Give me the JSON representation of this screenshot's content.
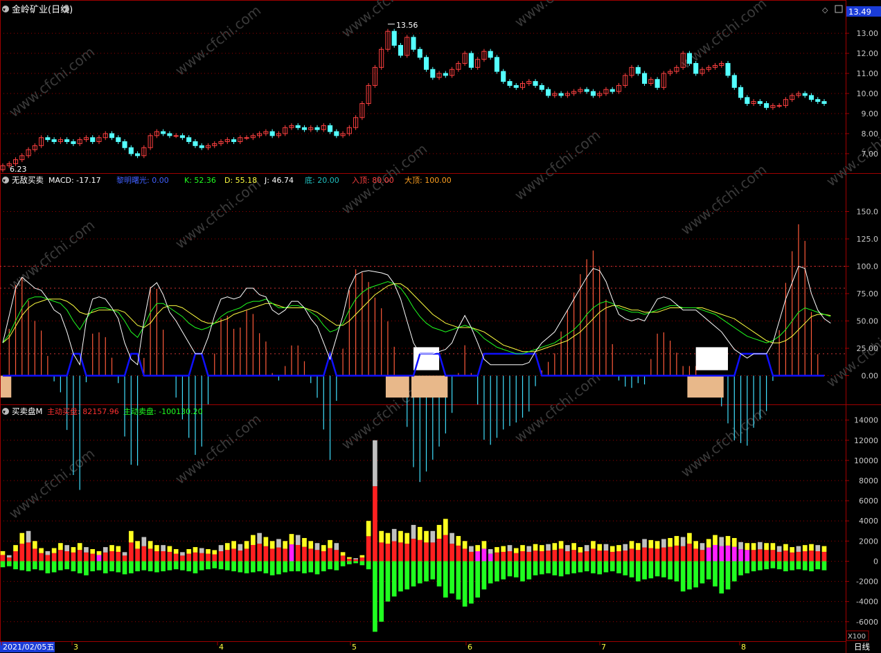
{
  "colors": {
    "up": "#ff4040",
    "down": "#54ffff",
    "frame": "#a00000",
    "grid": "#a00000",
    "axis_text": "#c8c8c8",
    "k_line": "#ffffff",
    "d_line": "#ffff40",
    "j_line": "#20ff20",
    "bottom_line": "#1010ff",
    "zone_fill": "#e8b88a",
    "buy_red": "#ff2020",
    "buy_yellow": "#ffff20",
    "buy_gray": "#c0c0c0",
    "buy_magenta": "#ff20ff",
    "sell_green": "#20ff20",
    "macd_pos": "#ff5a3a",
    "macd_neg": "#40e0ff"
  },
  "price_panel": {
    "title": "金岭矿业(日线)",
    "current_price": "13.49",
    "high_label": "13.56",
    "low_label": "6.23",
    "y_ticks": [
      "13.00",
      "12.00",
      "11.00",
      "10.00",
      "9.00",
      "8.00",
      "7.00"
    ]
  },
  "indicator_panel": {
    "title": "无敌买卖",
    "labels": [
      {
        "text": "MACD: -17.17",
        "color": "#ffffff"
      },
      {
        "text": "黎明曙光: 0.00",
        "color": "#4060ff"
      },
      {
        "text": "K: 52.36",
        "color": "#20ff20"
      },
      {
        "text": "D: 55.18",
        "color": "#ffff40"
      },
      {
        "text": "J: 46.74",
        "color": "#ffffff"
      },
      {
        "text": "底: 20.00",
        "color": "#20c0c0"
      },
      {
        "text": "入顶: 80.00",
        "color": "#ff4040"
      },
      {
        "text": "大顶: 100.00",
        "color": "#ffa020"
      }
    ],
    "y_ticks": [
      "150.0",
      "125.0",
      "100.0",
      "75.00",
      "50.00",
      "25.00",
      "0.00"
    ]
  },
  "volume_panel": {
    "title": "买卖盘M",
    "labels": [
      {
        "text": "主动买盘: 82157.96",
        "color": "#ff3030"
      },
      {
        "text": "主动卖盘: -100130.20",
        "color": "#20ff20"
      }
    ],
    "y_ticks": [
      "14000",
      "12000",
      "10000",
      "8000",
      "6000",
      "4000",
      "2000",
      "0",
      "-2000",
      "-4000",
      "-6000"
    ]
  },
  "x_axis": {
    "labels": [
      "2021/02/05五",
      "3",
      "4",
      "5",
      "6",
      "7",
      "8"
    ],
    "period": "日线",
    "zoom": "X100"
  },
  "watermark": "www.cfchi.com",
  "chart_data": [
    {
      "type": "candlestick",
      "title": "金岭矿业(日线)",
      "ylim": [
        6.1,
        13.9
      ],
      "high": 13.56,
      "low": 6.23,
      "close": [
        6.4,
        6.5,
        6.7,
        6.9,
        7.2,
        7.4,
        7.8,
        7.7,
        7.6,
        7.7,
        7.6,
        7.5,
        7.7,
        7.8,
        7.6,
        7.8,
        8.0,
        7.8,
        7.6,
        7.3,
        7.0,
        6.9,
        7.3,
        7.9,
        8.1,
        8.0,
        7.9,
        7.9,
        7.8,
        7.6,
        7.4,
        7.3,
        7.4,
        7.5,
        7.6,
        7.7,
        7.6,
        7.8,
        7.8,
        7.9,
        8.0,
        8.1,
        7.9,
        8.0,
        8.3,
        8.4,
        8.3,
        8.2,
        8.3,
        8.2,
        8.4,
        8.1,
        7.9,
        8.0,
        8.3,
        8.8,
        9.5,
        10.4,
        11.3,
        12.2,
        13.1,
        12.4,
        11.9,
        12.8,
        12.2,
        11.8,
        11.2,
        10.8,
        11.0,
        10.9,
        11.2,
        11.5,
        12.0,
        11.3,
        11.7,
        12.1,
        11.8,
        11.1,
        10.6,
        10.4,
        10.3,
        10.5,
        10.6,
        10.4,
        10.2,
        9.9,
        10.0,
        9.9,
        10.0,
        10.1,
        10.2,
        10.1,
        9.9,
        10.0,
        10.2,
        10.1,
        10.4,
        10.9,
        11.3,
        11.0,
        10.5,
        10.7,
        10.3,
        11.0,
        11.1,
        11.3,
        12.0,
        11.5,
        11.0,
        11.2,
        11.3,
        11.4,
        11.5,
        10.9,
        10.3,
        9.8,
        9.5,
        9.6,
        9.5,
        9.3,
        9.4,
        9.4,
        9.7,
        9.9,
        10.0,
        9.9,
        9.7,
        9.6,
        9.5
      ]
    },
    {
      "type": "line",
      "title": "无敌买卖",
      "ylim": [
        -25,
        175
      ],
      "series": [
        {
          "name": "K",
          "values": [
            30,
            38,
            50,
            62,
            70,
            72,
            72,
            70,
            68,
            66,
            60,
            50,
            42,
            52,
            60,
            62,
            62,
            60,
            58,
            50,
            40,
            35,
            45,
            58,
            66,
            66,
            62,
            58,
            54,
            48,
            44,
            42,
            44,
            48,
            54,
            58,
            60,
            62,
            66,
            68,
            68,
            70,
            66,
            62,
            62,
            64,
            64,
            62,
            58,
            54,
            46,
            40,
            42,
            48,
            60,
            70,
            76,
            80,
            82,
            84,
            86,
            84,
            80,
            72,
            62,
            54,
            48,
            44,
            42,
            40,
            42,
            44,
            46,
            44,
            40,
            34,
            30,
            26,
            24,
            22,
            20,
            20,
            22,
            24,
            26,
            28,
            30,
            34,
            38,
            42,
            48,
            56,
            62,
            66,
            68,
            66,
            62,
            60,
            58,
            58,
            56,
            58,
            60,
            62,
            64,
            64,
            62,
            62,
            62,
            60,
            58,
            56,
            52,
            48,
            44,
            40,
            36,
            34,
            32,
            30,
            32,
            36,
            42,
            50,
            58,
            62,
            60,
            58,
            56,
            54
          ]
        },
        {
          "name": "D",
          "values": [
            30,
            35,
            45,
            55,
            62,
            66,
            68,
            70,
            70,
            70,
            68,
            64,
            58,
            56,
            58,
            60,
            60,
            60,
            60,
            58,
            52,
            46,
            44,
            48,
            56,
            62,
            64,
            64,
            62,
            58,
            54,
            50,
            48,
            48,
            50,
            52,
            56,
            58,
            60,
            62,
            64,
            66,
            66,
            64,
            62,
            62,
            62,
            62,
            60,
            58,
            54,
            50,
            46,
            46,
            50,
            56,
            62,
            68,
            74,
            78,
            82,
            84,
            84,
            80,
            74,
            68,
            62,
            56,
            52,
            48,
            46,
            44,
            44,
            44,
            42,
            40,
            36,
            32,
            28,
            26,
            24,
            22,
            22,
            22,
            24,
            26,
            28,
            30,
            32,
            36,
            40,
            46,
            52,
            58,
            62,
            64,
            64,
            62,
            60,
            60,
            58,
            58,
            58,
            60,
            62,
            62,
            62,
            62,
            62,
            62,
            60,
            58,
            56,
            54,
            52,
            48,
            44,
            40,
            36,
            32,
            30,
            30,
            32,
            36,
            42,
            48,
            54,
            56,
            56,
            55
          ]
        },
        {
          "name": "J",
          "values": [
            30,
            55,
            80,
            90,
            85,
            80,
            78,
            70,
            60,
            56,
            40,
            20,
            10,
            50,
            70,
            72,
            70,
            62,
            52,
            30,
            15,
            10,
            50,
            80,
            85,
            74,
            58,
            50,
            40,
            30,
            20,
            20,
            35,
            55,
            70,
            72,
            70,
            72,
            80,
            80,
            74,
            72,
            60,
            56,
            60,
            68,
            68,
            62,
            52,
            45,
            30,
            15,
            35,
            55,
            80,
            92,
            95,
            96,
            95,
            94,
            92,
            84,
            70,
            50,
            30,
            20,
            20,
            20,
            22,
            24,
            30,
            44,
            55,
            44,
            30,
            15,
            10,
            10,
            10,
            10,
            10,
            10,
            12,
            22,
            30,
            35,
            40,
            50,
            60,
            70,
            80,
            90,
            98,
            96,
            86,
            70,
            56,
            52,
            50,
            52,
            50,
            60,
            70,
            72,
            70,
            65,
            60,
            60,
            60,
            55,
            50,
            45,
            40,
            32,
            24,
            20,
            16,
            20,
            20,
            20,
            30,
            50,
            70,
            85,
            100,
            98,
            75,
            60,
            52,
            48
          ]
        }
      ],
      "hlines": {
        "bottom": 20,
        "top": 80,
        "big_top": 100
      }
    },
    {
      "type": "bar",
      "title": "买卖盘M",
      "ylim": [
        -7800,
        14800
      ],
      "series": [
        {
          "name": "主动买盘",
          "values": [
            1000,
            600,
            1600,
            2800,
            3000,
            2000,
            1300,
            1000,
            1300,
            1800,
            1600,
            1400,
            1800,
            1400,
            1200,
            1000,
            1400,
            1600,
            1500,
            900,
            3000,
            2000,
            2400,
            2000,
            1600,
            1600,
            1500,
            1200,
            900,
            1200,
            1400,
            1300,
            1200,
            1100,
            1600,
            1800,
            2000,
            1700,
            2000,
            2600,
            2800,
            2400,
            2000,
            2200,
            2000,
            2700,
            2600,
            2300,
            2000,
            1800,
            1600,
            2100,
            1800,
            900,
            400,
            300,
            600,
            4000,
            12000,
            3000,
            2800,
            3200,
            3000,
            2800,
            3600,
            3400,
            3000,
            3000,
            3600,
            4200,
            2800,
            2500,
            2000,
            1500,
            1600,
            2000,
            1200,
            1400,
            1500,
            1600,
            1300,
            1600,
            1500,
            1700,
            1600,
            1700,
            1800,
            2000,
            1600,
            1800,
            1400,
            1600,
            2000,
            1700,
            1700,
            1500,
            1600,
            1700,
            2000,
            1800,
            2200,
            2100,
            2000,
            2200,
            2300,
            2500,
            2400,
            2800,
            2000,
            1800,
            2200,
            2600,
            2400,
            2500,
            2300,
            1900,
            1800,
            1800,
            1900,
            1800,
            1800,
            1500,
            1700,
            1400,
            1500,
            1600,
            1700,
            1600,
            1500,
            1500
          ]
        },
        {
          "name": "主动卖盘",
          "values": [
            -600,
            -500,
            -800,
            -900,
            -1000,
            -800,
            -900,
            -1200,
            -1100,
            -900,
            -800,
            -1000,
            -1200,
            -1400,
            -1000,
            -900,
            -1200,
            -1000,
            -1100,
            -1300,
            -1200,
            -1000,
            -900,
            -1000,
            -1100,
            -1000,
            -900,
            -800,
            -900,
            -1000,
            -1200,
            -900,
            -800,
            -700,
            -800,
            -900,
            -1000,
            -1100,
            -1200,
            -1100,
            -1000,
            -1200,
            -1400,
            -1300,
            -1100,
            -1000,
            -1000,
            -1200,
            -1100,
            -1300,
            -1000,
            -800,
            -900,
            -500,
            -300,
            -200,
            -400,
            -800,
            -7000,
            -6000,
            -4000,
            -3500,
            -3000,
            -2800,
            -2500,
            -2200,
            -2000,
            -1800,
            -2500,
            -3600,
            -3200,
            -3800,
            -4500,
            -4200,
            -3600,
            -2800,
            -2200,
            -2000,
            -1800,
            -1500,
            -1600,
            -2000,
            -1800,
            -1400,
            -1300,
            -1200,
            -1400,
            -1500,
            -1300,
            -1200,
            -1100,
            -1000,
            -1200,
            -1300,
            -1100,
            -1000,
            -1200,
            -1400,
            -1600,
            -2000,
            -1800,
            -1700,
            -1500,
            -1600,
            -1800,
            -2000,
            -3000,
            -2800,
            -2600,
            -2200,
            -1800,
            -2500,
            -3200,
            -2800,
            -2000,
            -1400,
            -1200,
            -1000,
            -900,
            -800,
            -700,
            -800,
            -1000,
            -900,
            -800,
            -900,
            -1000,
            -800,
            -900,
            -800
          ]
        }
      ]
    }
  ]
}
